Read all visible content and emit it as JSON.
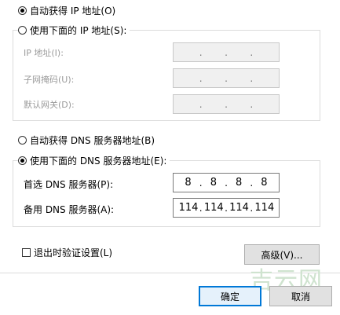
{
  "ip": {
    "auto_label": "自动获得 IP 地址(O)",
    "manual_label": "使用下面的 IP 地址(S):",
    "address_label": "IP 地址(I):",
    "subnet_label": "子网掩码(U):",
    "gateway_label": "默认网关(D):"
  },
  "dns": {
    "auto_label": "自动获得 DNS 服务器地址(B)",
    "manual_label": "使用下面的 DNS 服务器地址(E):",
    "preferred_label": "首选 DNS 服务器(P):",
    "preferred_value": [
      "8",
      "8",
      "8",
      "8"
    ],
    "alternate_label": "备用 DNS 服务器(A):",
    "alternate_value": [
      "114",
      "114",
      "114",
      "114"
    ]
  },
  "validate_label": "退出时验证设置(L)",
  "advanced_button": "高级(V)...",
  "ok_button": "确定",
  "cancel_button": "取消",
  "watermark": "吉云网"
}
